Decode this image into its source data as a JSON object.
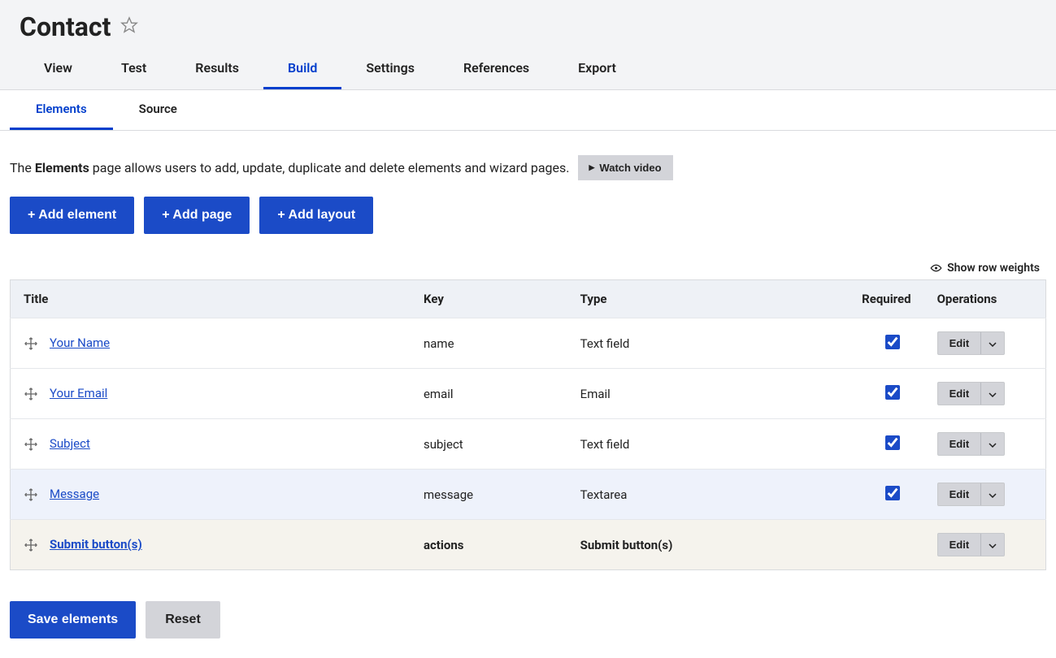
{
  "page": {
    "title": "Contact"
  },
  "primary_tabs": [
    {
      "label": "View",
      "active": false
    },
    {
      "label": "Test",
      "active": false
    },
    {
      "label": "Results",
      "active": false
    },
    {
      "label": "Build",
      "active": true
    },
    {
      "label": "Settings",
      "active": false
    },
    {
      "label": "References",
      "active": false
    },
    {
      "label": "Export",
      "active": false
    }
  ],
  "secondary_tabs": [
    {
      "label": "Elements",
      "active": true
    },
    {
      "label": "Source",
      "active": false
    }
  ],
  "help": {
    "prefix": "The ",
    "bold": "Elements",
    "suffix": " page allows users to add, update, duplicate and delete elements and wizard pages.",
    "watch_video": "Watch video"
  },
  "action_buttons": {
    "add_element": "+ Add element",
    "add_page": "+ Add page",
    "add_layout": "+ Add layout"
  },
  "row_weights": "Show row weights",
  "table": {
    "headers": {
      "title": "Title",
      "key": "Key",
      "type": "Type",
      "required": "Required",
      "operations": "Operations"
    },
    "rows": [
      {
        "title": "Your Name",
        "key": "name",
        "type": "Text field",
        "required": true,
        "variant": "normal"
      },
      {
        "title": "Your Email",
        "key": "email",
        "type": "Email",
        "required": true,
        "variant": "normal"
      },
      {
        "title": "Subject",
        "key": "subject",
        "type": "Text field",
        "required": true,
        "variant": "normal"
      },
      {
        "title": "Message",
        "key": "message",
        "type": "Textarea",
        "required": true,
        "variant": "highlight"
      },
      {
        "title": "Submit button(s)",
        "key": "actions",
        "type": "Submit button(s)",
        "required": null,
        "variant": "actions"
      }
    ],
    "edit_label": "Edit"
  },
  "footer": {
    "save": "Save elements",
    "reset": "Reset"
  }
}
